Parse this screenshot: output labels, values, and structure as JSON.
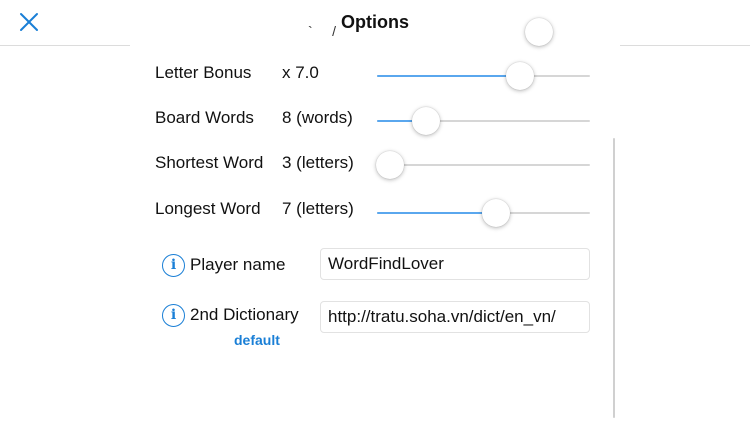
{
  "header": {
    "title": "Options",
    "close_icon": "close-icon"
  },
  "sliders": [
    {
      "id": "partial",
      "label": "",
      "value_text": "",
      "fraction": 0.76
    },
    {
      "id": "letter-bonus",
      "label": "Letter Bonus",
      "value_text": "x 7.0",
      "fraction": 0.67
    },
    {
      "id": "board-words",
      "label": "Board Words",
      "value_text": "8 (words)",
      "fraction": 0.23
    },
    {
      "id": "shortest-word",
      "label": "Shortest Word",
      "value_text": "3 (letters)",
      "fraction": 0.06
    },
    {
      "id": "longest-word",
      "label": "Longest Word",
      "value_text": "7 (letters)",
      "fraction": 0.56
    }
  ],
  "player": {
    "label": "Player name",
    "value": "WordFindLover"
  },
  "dictionary": {
    "label": "2nd Dictionary",
    "value": "http://tratu.soha.vn/dict/en_vn/",
    "default_label": "default"
  },
  "colors": {
    "accent": "#1a7fd6",
    "slider_fill": "#5aa7ee",
    "slider_track": "#d6d6d6"
  }
}
